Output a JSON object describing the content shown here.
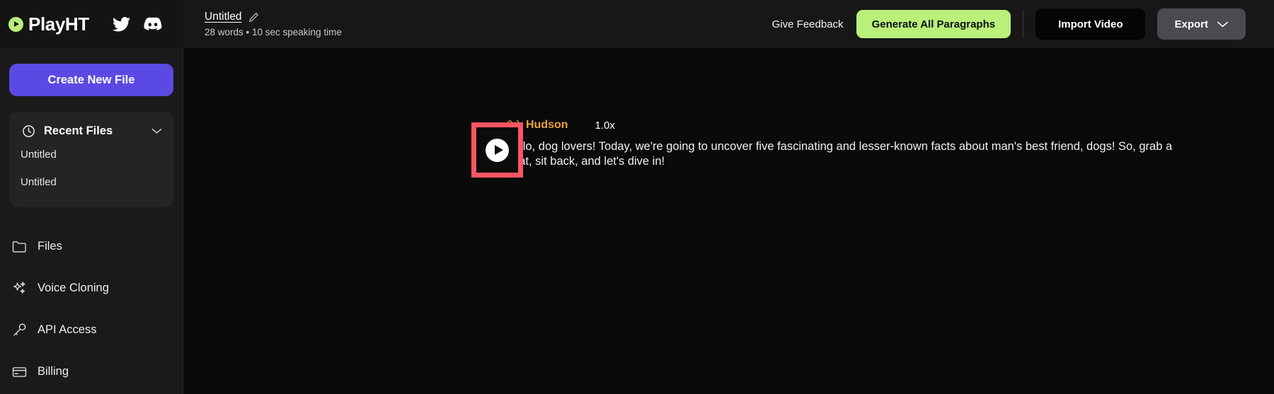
{
  "brand": {
    "name": "PlayHT",
    "logo_icon": "play-circle-icon",
    "logo_color": "#b8f07a",
    "social": [
      {
        "icon": "twitter-icon",
        "label": "Twitter"
      },
      {
        "icon": "discord-icon",
        "label": "Discord"
      }
    ]
  },
  "header": {
    "doc_title": "Untitled",
    "edit_icon": "pencil-edit-icon",
    "doc_subtitle": "28 words • 10 sec speaking time",
    "feedback_label": "Give Feedback",
    "generate_label": "Generate All Paragraphs",
    "generate_color": "#b8f07a",
    "import_label": "Import Video",
    "export_label": "Export",
    "export_chevron_icon": "chevron-down-icon"
  },
  "sidebar": {
    "create_label": "Create New File",
    "create_color": "#5a4ae3",
    "recent": {
      "icon": "clock-icon",
      "title": "Recent Files",
      "collapse_icon": "chevron-down-icon",
      "items": [
        {
          "label": "Untitled"
        },
        {
          "label": "Untitled"
        }
      ]
    },
    "nav": [
      {
        "icon": "folder-icon",
        "label": "Files"
      },
      {
        "icon": "sparkles-icon",
        "label": "Voice Cloning"
      },
      {
        "icon": "key-icon",
        "label": "API Access"
      },
      {
        "icon": "credit-card-icon",
        "label": "Billing"
      }
    ]
  },
  "editor": {
    "paragraph": {
      "play_icon": "play-button-icon",
      "highlight_color": "#fc5563",
      "voice_icon": "voice-speaker-icon",
      "voice_name": "Hudson",
      "voice_color": "#e8a33d",
      "speed": "1.0x",
      "text": "Hello, dog lovers! Today, we're going to uncover five fascinating and lesser-known facts about man's best friend, dogs! So, grab a treat, sit back, and let's dive in!"
    }
  }
}
